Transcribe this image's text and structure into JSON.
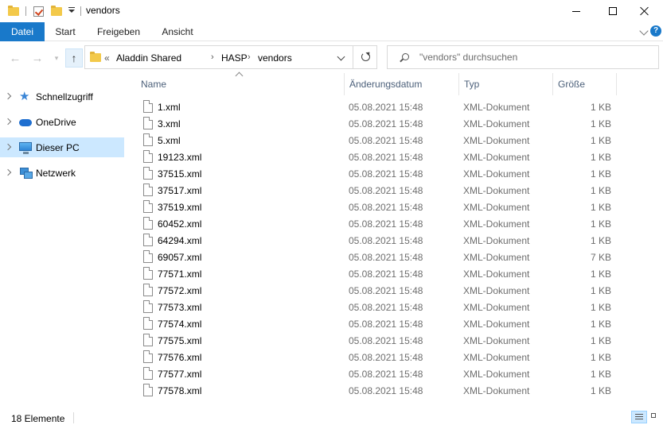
{
  "window": {
    "title": "vendors"
  },
  "ribbon": {
    "tabs": [
      "Datei",
      "Start",
      "Freigeben",
      "Ansicht"
    ]
  },
  "address": {
    "overflow": "«",
    "segments": [
      "Aladdin Shared",
      "HASP",
      "vendors"
    ]
  },
  "search": {
    "placeholder": "\"vendors\" durchsuchen"
  },
  "sidebar": {
    "items": [
      {
        "label": "Schnellzugriff",
        "icon": "star-icon"
      },
      {
        "label": "OneDrive",
        "icon": "cloud-icon"
      },
      {
        "label": "Dieser PC",
        "icon": "computer-icon",
        "selected": true
      },
      {
        "label": "Netzwerk",
        "icon": "network-icon"
      }
    ]
  },
  "columns": {
    "name": "Name",
    "date": "Änderungsdatum",
    "type": "Typ",
    "size": "Größe"
  },
  "files": [
    {
      "name": "1.xml",
      "date": "05.08.2021 15:48",
      "type": "XML-Dokument",
      "size": "1 KB"
    },
    {
      "name": "3.xml",
      "date": "05.08.2021 15:48",
      "type": "XML-Dokument",
      "size": "1 KB"
    },
    {
      "name": "5.xml",
      "date": "05.08.2021 15:48",
      "type": "XML-Dokument",
      "size": "1 KB"
    },
    {
      "name": "19123.xml",
      "date": "05.08.2021 15:48",
      "type": "XML-Dokument",
      "size": "1 KB"
    },
    {
      "name": "37515.xml",
      "date": "05.08.2021 15:48",
      "type": "XML-Dokument",
      "size": "1 KB"
    },
    {
      "name": "37517.xml",
      "date": "05.08.2021 15:48",
      "type": "XML-Dokument",
      "size": "1 KB"
    },
    {
      "name": "37519.xml",
      "date": "05.08.2021 15:48",
      "type": "XML-Dokument",
      "size": "1 KB"
    },
    {
      "name": "60452.xml",
      "date": "05.08.2021 15:48",
      "type": "XML-Dokument",
      "size": "1 KB"
    },
    {
      "name": "64294.xml",
      "date": "05.08.2021 15:48",
      "type": "XML-Dokument",
      "size": "1 KB"
    },
    {
      "name": "69057.xml",
      "date": "05.08.2021 15:48",
      "type": "XML-Dokument",
      "size": "7 KB"
    },
    {
      "name": "77571.xml",
      "date": "05.08.2021 15:48",
      "type": "XML-Dokument",
      "size": "1 KB"
    },
    {
      "name": "77572.xml",
      "date": "05.08.2021 15:48",
      "type": "XML-Dokument",
      "size": "1 KB"
    },
    {
      "name": "77573.xml",
      "date": "05.08.2021 15:48",
      "type": "XML-Dokument",
      "size": "1 KB"
    },
    {
      "name": "77574.xml",
      "date": "05.08.2021 15:48",
      "type": "XML-Dokument",
      "size": "1 KB"
    },
    {
      "name": "77575.xml",
      "date": "05.08.2021 15:48",
      "type": "XML-Dokument",
      "size": "1 KB"
    },
    {
      "name": "77576.xml",
      "date": "05.08.2021 15:48",
      "type": "XML-Dokument",
      "size": "1 KB"
    },
    {
      "name": "77577.xml",
      "date": "05.08.2021 15:48",
      "type": "XML-Dokument",
      "size": "1 KB"
    },
    {
      "name": "77578.xml",
      "date": "05.08.2021 15:48",
      "type": "XML-Dokument",
      "size": "1 KB"
    }
  ],
  "status": {
    "count": "18 Elemente"
  },
  "colors": {
    "accent": "#1979ca",
    "selection": "#cce8ff",
    "header_text": "#4c607a",
    "muted_text": "#6d6d6d"
  }
}
